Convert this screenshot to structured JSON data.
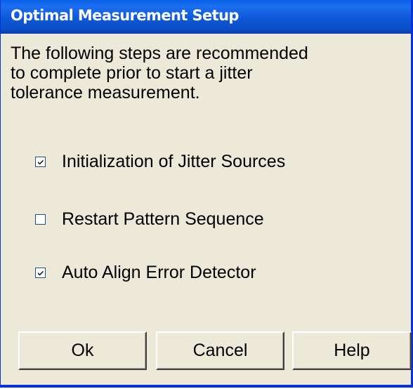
{
  "window": {
    "title": "Optimal Measurement Setup"
  },
  "description": {
    "lines": [
      "The following steps are recommended",
      "to complete prior to start a jitter",
      "tolerance measurement."
    ]
  },
  "options": [
    {
      "label": "Initialization of Jitter Sources",
      "checked": true
    },
    {
      "label": "Restart Pattern Sequence",
      "checked": false
    },
    {
      "label": "Auto Align Error Detector",
      "checked": true
    }
  ],
  "buttons": {
    "ok": "Ok",
    "cancel": "Cancel",
    "help": "Help"
  },
  "colors": {
    "titlebar": "#0a5fe8",
    "frame": "#0831d9",
    "face": "#ece9d8",
    "checkbox_border": "#1c5180"
  }
}
